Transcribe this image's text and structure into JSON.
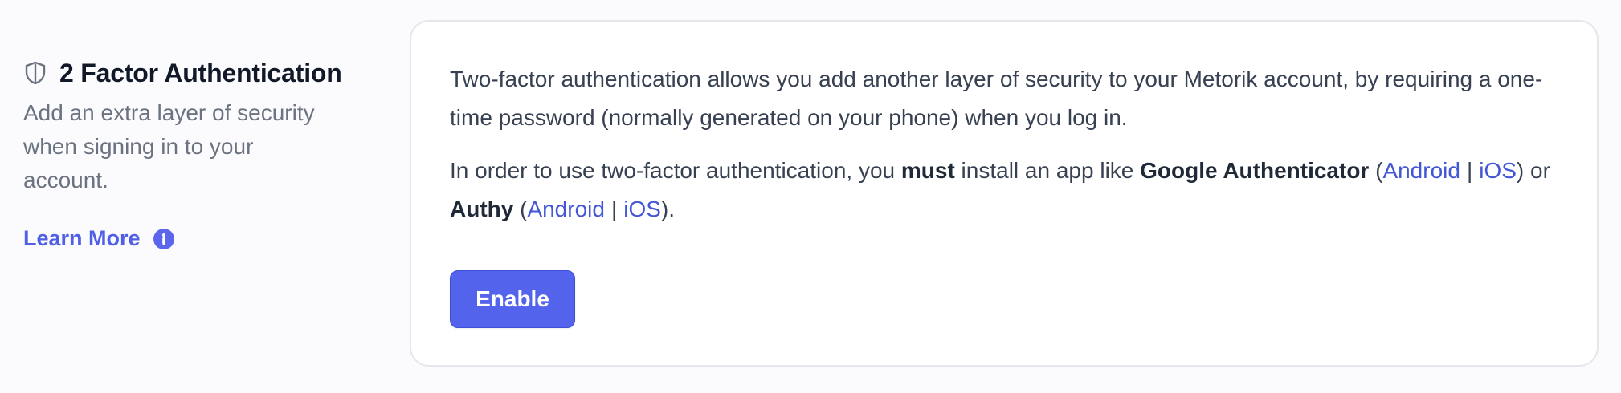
{
  "section": {
    "icon": "shield-icon",
    "title": "2 Factor Authentication",
    "description": "Add an extra layer of security when signing in to your account.",
    "learn_more": {
      "label": "Learn More",
      "icon": "info-icon"
    }
  },
  "card": {
    "paragraph1": "Two-factor authentication allows you add another layer of security to your Metorik account, by requiring a one-time password (normally generated on your phone) when you log in.",
    "paragraph2": {
      "t1": "In order to use two-factor authentication, you ",
      "must": "must",
      "t2": " install an app like ",
      "google_authenticator": "Google Authenticator",
      "open_paren1": " (",
      "ga_android": "Android",
      "separator1": "|",
      "ga_ios": "iOS",
      "close_or": ") or ",
      "authy": "Authy",
      "open_paren2": " (",
      "authy_android": "Android",
      "separator2": "|",
      "authy_ios": "iOS",
      "close_end": ")."
    },
    "enable_label": "Enable"
  },
  "colors": {
    "accent": "#5463ec",
    "link": "#4356d6",
    "background": "#fbfbfe",
    "card_border": "#e5e7eb"
  }
}
